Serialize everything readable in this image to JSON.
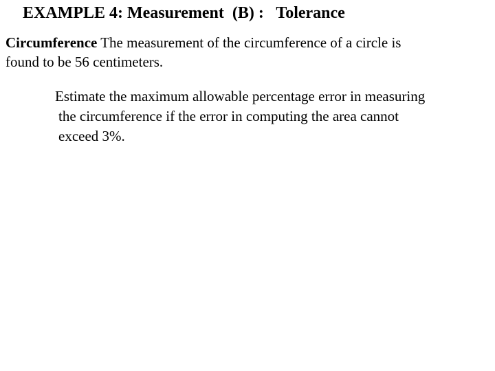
{
  "slide": {
    "title": "EXAMPLE 4: Measurement  (B) :   Tolerance",
    "paragraph1": {
      "term": "Circumference",
      "line1": " The measurement of the circumference of a circle is",
      "line2": "found to be 56 centimeters."
    },
    "paragraph2": {
      "line1": "Estimate the maximum allowable percentage error in measuring",
      "line2": "the circumference if the error in computing the area cannot",
      "line3": "exceed 3%."
    }
  }
}
